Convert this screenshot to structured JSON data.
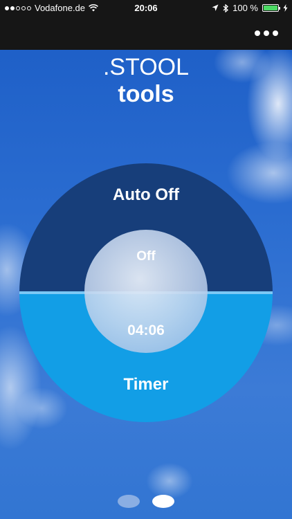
{
  "status_bar": {
    "signal_strength": "2 of 5",
    "carrier": "Vodafone.de",
    "time": "20:06",
    "battery_percent": "100 %",
    "icons": [
      "wifi-icon",
      "location-arrow-icon",
      "bluetooth-icon",
      "battery-icon",
      "charging-bolt-icon"
    ]
  },
  "nav": {
    "more_icon": "more-dots-icon"
  },
  "title": {
    "line1": ".STOOL",
    "line2": "tools"
  },
  "dial": {
    "top_label": "Auto Off",
    "top_value": "Off",
    "bottom_label": "Timer",
    "bottom_value": "04:06",
    "colors": {
      "top_half": "#173e7a",
      "bottom_half": "#129ee6",
      "divider": "#7cc8f5",
      "center_disc": "#c9d9ee"
    }
  },
  "pager": {
    "pages": 2,
    "current_page": 2
  },
  "colors": {
    "status_bar_bg": "#161616",
    "battery_fill": "#4cd964"
  }
}
